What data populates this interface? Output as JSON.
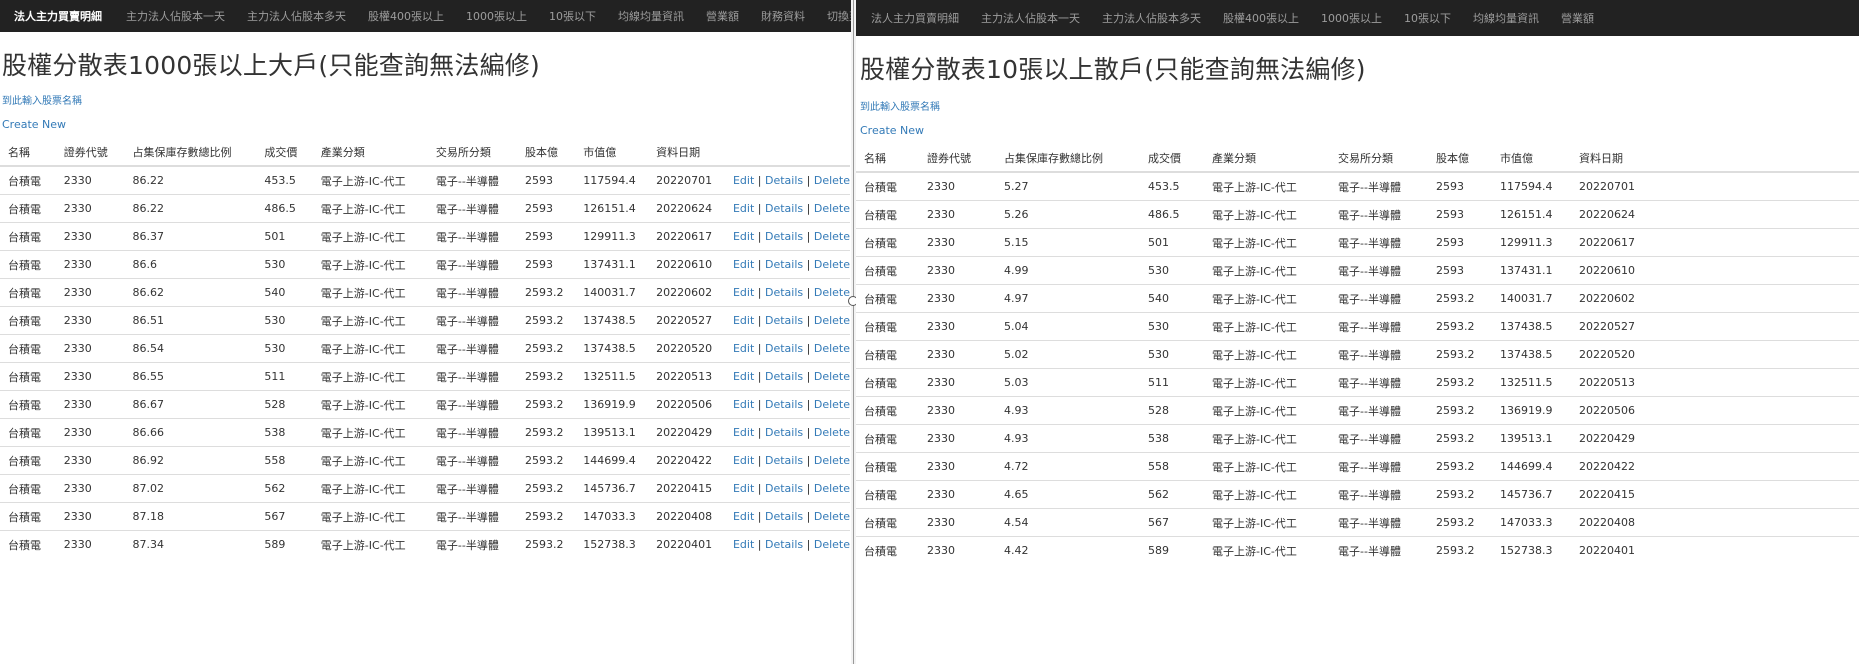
{
  "left": {
    "nav": {
      "brand": "法人主力買賣明細",
      "items": [
        "主力法人佔股本一天",
        "主力法人佔股本多天",
        "股權400張以上",
        "1000張以上",
        "10張以下",
        "均線均量資訊",
        "營業額",
        "財務資料",
        "切換至"
      ]
    },
    "title": "股權分散表1000張以上大戶(只能查詢無法編修)",
    "stock_link": "到此輸入股票名稱",
    "create_link": "Create New",
    "headers": [
      "名稱",
      "證券代號",
      "占集保庫存數總比例",
      "成交價",
      "產業分類",
      "交易所分類",
      "股本億",
      "市值億",
      "資料日期",
      ""
    ],
    "actions": {
      "edit": "Edit",
      "details": "Details",
      "delete": "Delete",
      "sep": "|"
    },
    "rows": [
      [
        "台積電",
        "2330",
        "86.22",
        "453.5",
        "電子上游-IC-代工",
        "電子--半導體",
        "2593",
        "117594.4",
        "20220701"
      ],
      [
        "台積電",
        "2330",
        "86.22",
        "486.5",
        "電子上游-IC-代工",
        "電子--半導體",
        "2593",
        "126151.4",
        "20220624"
      ],
      [
        "台積電",
        "2330",
        "86.37",
        "501",
        "電子上游-IC-代工",
        "電子--半導體",
        "2593",
        "129911.3",
        "20220617"
      ],
      [
        "台積電",
        "2330",
        "86.6",
        "530",
        "電子上游-IC-代工",
        "電子--半導體",
        "2593",
        "137431.1",
        "20220610"
      ],
      [
        "台積電",
        "2330",
        "86.62",
        "540",
        "電子上游-IC-代工",
        "電子--半導體",
        "2593.2",
        "140031.7",
        "20220602"
      ],
      [
        "台積電",
        "2330",
        "86.51",
        "530",
        "電子上游-IC-代工",
        "電子--半導體",
        "2593.2",
        "137438.5",
        "20220527"
      ],
      [
        "台積電",
        "2330",
        "86.54",
        "530",
        "電子上游-IC-代工",
        "電子--半導體",
        "2593.2",
        "137438.5",
        "20220520"
      ],
      [
        "台積電",
        "2330",
        "86.55",
        "511",
        "電子上游-IC-代工",
        "電子--半導體",
        "2593.2",
        "132511.5",
        "20220513"
      ],
      [
        "台積電",
        "2330",
        "86.67",
        "528",
        "電子上游-IC-代工",
        "電子--半導體",
        "2593.2",
        "136919.9",
        "20220506"
      ],
      [
        "台積電",
        "2330",
        "86.66",
        "538",
        "電子上游-IC-代工",
        "電子--半導體",
        "2593.2",
        "139513.1",
        "20220429"
      ],
      [
        "台積電",
        "2330",
        "86.92",
        "558",
        "電子上游-IC-代工",
        "電子--半導體",
        "2593.2",
        "144699.4",
        "20220422"
      ],
      [
        "台積電",
        "2330",
        "87.02",
        "562",
        "電子上游-IC-代工",
        "電子--半導體",
        "2593.2",
        "145736.7",
        "20220415"
      ],
      [
        "台積電",
        "2330",
        "87.18",
        "567",
        "電子上游-IC-代工",
        "電子--半導體",
        "2593.2",
        "147033.3",
        "20220408"
      ],
      [
        "台積電",
        "2330",
        "87.34",
        "589",
        "電子上游-IC-代工",
        "電子--半導體",
        "2593.2",
        "152738.3",
        "20220401"
      ]
    ]
  },
  "right": {
    "nav": {
      "items": [
        "法人主力買賣明細",
        "主力法人佔股本一天",
        "主力法人佔股本多天",
        "股權400張以上",
        "1000張以上",
        "10張以下",
        "均線均量資訊",
        "營業額"
      ]
    },
    "title": "股權分散表10張以上散戶(只能查詢無法編修)",
    "stock_link": "到此輸入股票名稱",
    "create_link": "Create New",
    "headers": [
      "名稱",
      "證券代號",
      "占集保庫存數總比例",
      "成交價",
      "產業分類",
      "交易所分類",
      "股本億",
      "市值億",
      "資料日期"
    ],
    "rows": [
      [
        "台積電",
        "2330",
        "5.27",
        "453.5",
        "電子上游-IC-代工",
        "電子--半導體",
        "2593",
        "117594.4",
        "20220701"
      ],
      [
        "台積電",
        "2330",
        "5.26",
        "486.5",
        "電子上游-IC-代工",
        "電子--半導體",
        "2593",
        "126151.4",
        "20220624"
      ],
      [
        "台積電",
        "2330",
        "5.15",
        "501",
        "電子上游-IC-代工",
        "電子--半導體",
        "2593",
        "129911.3",
        "20220617"
      ],
      [
        "台積電",
        "2330",
        "4.99",
        "530",
        "電子上游-IC-代工",
        "電子--半導體",
        "2593",
        "137431.1",
        "20220610"
      ],
      [
        "台積電",
        "2330",
        "4.97",
        "540",
        "電子上游-IC-代工",
        "電子--半導體",
        "2593.2",
        "140031.7",
        "20220602"
      ],
      [
        "台積電",
        "2330",
        "5.04",
        "530",
        "電子上游-IC-代工",
        "電子--半導體",
        "2593.2",
        "137438.5",
        "20220527"
      ],
      [
        "台積電",
        "2330",
        "5.02",
        "530",
        "電子上游-IC-代工",
        "電子--半導體",
        "2593.2",
        "137438.5",
        "20220520"
      ],
      [
        "台積電",
        "2330",
        "5.03",
        "511",
        "電子上游-IC-代工",
        "電子--半導體",
        "2593.2",
        "132511.5",
        "20220513"
      ],
      [
        "台積電",
        "2330",
        "4.93",
        "528",
        "電子上游-IC-代工",
        "電子--半導體",
        "2593.2",
        "136919.9",
        "20220506"
      ],
      [
        "台積電",
        "2330",
        "4.93",
        "538",
        "電子上游-IC-代工",
        "電子--半導體",
        "2593.2",
        "139513.1",
        "20220429"
      ],
      [
        "台積電",
        "2330",
        "4.72",
        "558",
        "電子上游-IC-代工",
        "電子--半導體",
        "2593.2",
        "144699.4",
        "20220422"
      ],
      [
        "台積電",
        "2330",
        "4.65",
        "562",
        "電子上游-IC-代工",
        "電子--半導體",
        "2593.2",
        "145736.7",
        "20220415"
      ],
      [
        "台積電",
        "2330",
        "4.54",
        "567",
        "電子上游-IC-代工",
        "電子--半導體",
        "2593.2",
        "147033.3",
        "20220408"
      ],
      [
        "台積電",
        "2330",
        "4.42",
        "589",
        "電子上游-IC-代工",
        "電子--半導體",
        "2593.2",
        "152738.3",
        "20220401"
      ]
    ]
  },
  "colors": {
    "navbar_bg": "#222222",
    "nav_text": "#9d9d9d",
    "link": "#337ab7",
    "text": "#333333",
    "border": "#dddddd"
  }
}
